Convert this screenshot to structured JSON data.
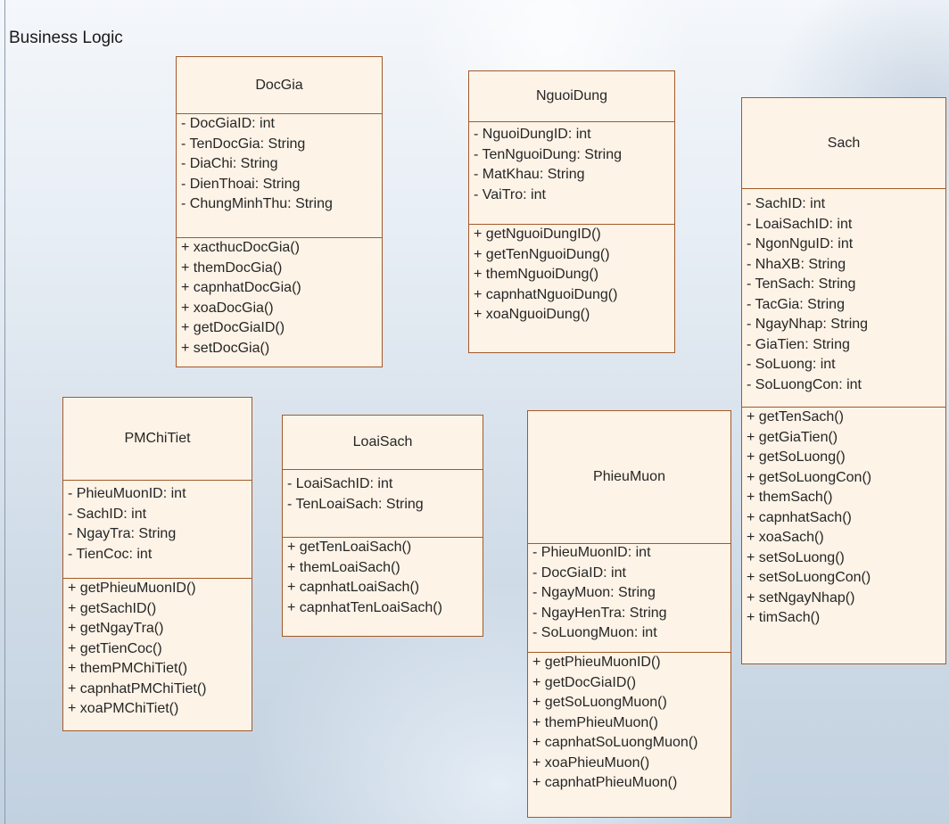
{
  "diagram": {
    "title": "Business Logic"
  },
  "classes": {
    "docgia": {
      "name": "DocGia",
      "attributes": [
        "- DocGiaID: int",
        "- TenDocGia: String",
        "- DiaChi: String",
        "- DienThoai: String",
        "- ChungMinhThu: String"
      ],
      "operations": [
        "+ xacthucDocGia()",
        "+ themDocGia()",
        "+ capnhatDocGia()",
        "+ xoaDocGia()",
        "+ getDocGiaID()",
        "+ setDocGia()"
      ]
    },
    "nguoidung": {
      "name": "NguoiDung",
      "attributes": [
        "- NguoiDungID: int",
        "- TenNguoiDung: String",
        "- MatKhau: String",
        "- VaiTro: int"
      ],
      "operations": [
        "+ getNguoiDungID()",
        "+ getTenNguoiDung()",
        "+ themNguoiDung()",
        "+ capnhatNguoiDung()",
        "+ xoaNguoiDung()"
      ]
    },
    "sach": {
      "name": "Sach",
      "attributes": [
        "- SachID: int",
        "- LoaiSachID: int",
        "- NgonNguID: int",
        "- NhaXB: String",
        "- TenSach: String",
        "- TacGia: String",
        "- NgayNhap: String",
        "- GiaTien: String",
        "- SoLuong: int",
        "- SoLuongCon: int"
      ],
      "operations": [
        "+ getTenSach()",
        "+ getGiaTien()",
        "+ getSoLuong()",
        "+ getSoLuongCon()",
        "+ themSach()",
        "+ capnhatSach()",
        "+ xoaSach()",
        "+ setSoLuong()",
        "+ setSoLuongCon()",
        "+ setNgayNhap()",
        "+ timSach()"
      ]
    },
    "pmchitiet": {
      "name": "PMChiTiet",
      "attributes": [
        "- PhieuMuonID: int",
        "- SachID: int",
        "- NgayTra: String",
        "- TienCoc: int"
      ],
      "operations": [
        "+ getPhieuMuonID()",
        "+ getSachID()",
        "+ getNgayTra()",
        "+ getTienCoc()",
        "+ themPMChiTiet()",
        "+ capnhatPMChiTiet()",
        "+ xoaPMChiTiet()"
      ]
    },
    "loaisach": {
      "name": "LoaiSach",
      "attributes": [
        "- LoaiSachID: int",
        "- TenLoaiSach: String"
      ],
      "operations": [
        "+ getTenLoaiSach()",
        "+ themLoaiSach()",
        "+ capnhatLoaiSach()",
        "+ capnhatTenLoaiSach()"
      ]
    },
    "phieumuon": {
      "name": "PhieuMuon",
      "attributes": [
        "- PhieuMuonID: int",
        "- DocGiaID: int",
        "- NgayMuon: String",
        "- NgayHenTra: String",
        "- SoLuongMuon: int"
      ],
      "operations": [
        "+ getPhieuMuonID()",
        "+ getDocGiaID()",
        "+ getSoLuongMuon()",
        "+ themPhieuMuon()",
        "+ capnhatSoLuongMuon()",
        "+ xoaPhieuMuon()",
        "+ capnhatPhieuMuon()"
      ]
    }
  }
}
